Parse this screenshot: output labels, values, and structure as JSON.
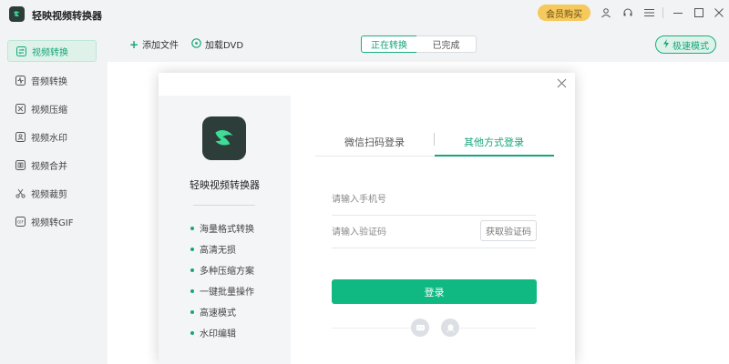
{
  "app": {
    "title": "轻映视频转换器",
    "accent": "#16a67a"
  },
  "titlebar": {
    "vip_label": "会员购买",
    "icons": [
      "user-icon",
      "headset-icon",
      "menu-icon",
      "minimize-icon",
      "maximize-icon",
      "close-icon"
    ]
  },
  "sidebar": {
    "items": [
      {
        "label": "视频转换",
        "icon": "video-convert-icon",
        "active": true
      },
      {
        "label": "音频转换",
        "icon": "audio-icon",
        "active": false
      },
      {
        "label": "视频压缩",
        "icon": "compress-icon",
        "active": false
      },
      {
        "label": "视频水印",
        "icon": "watermark-icon",
        "active": false
      },
      {
        "label": "视频合并",
        "icon": "merge-icon",
        "active": false
      },
      {
        "label": "视频裁剪",
        "icon": "scissors-icon",
        "active": false
      },
      {
        "label": "视频转GIF",
        "icon": "gif-icon",
        "active": false
      }
    ]
  },
  "toolbar": {
    "add_file": "添加文件",
    "load_dvd": "加载DVD",
    "tab_converting": "正在转换",
    "tab_done": "已完成",
    "turbo": "极速模式"
  },
  "login": {
    "brand_name": "轻映视频转换器",
    "features": [
      "海量格式转换",
      "高清无损",
      "多种压缩方案",
      "一键批量操作",
      "高速模式",
      "水印编辑"
    ],
    "tabs": {
      "wechat": "微信扫码登录",
      "other": "其他方式登录"
    },
    "phone_placeholder": "请输入手机号",
    "code_placeholder": "请输入验证码",
    "get_code": "获取验证码",
    "submit": "登录"
  }
}
